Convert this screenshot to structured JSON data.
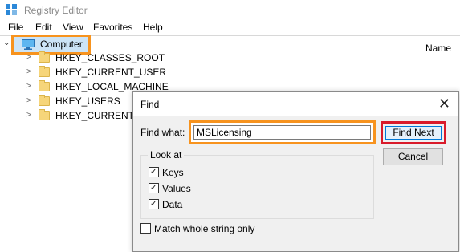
{
  "window": {
    "title": "Registry Editor",
    "menu": [
      "File",
      "Edit",
      "View",
      "Favorites",
      "Help"
    ]
  },
  "tree": {
    "root": "Computer",
    "items": [
      "HKEY_CLASSES_ROOT",
      "HKEY_CURRENT_USER",
      "HKEY_LOCAL_MACHINE",
      "HKEY_USERS",
      "HKEY_CURRENT_C"
    ]
  },
  "list": {
    "column_name": "Name"
  },
  "find_dialog": {
    "title": "Find",
    "close_glyph": "✕",
    "find_what_label": "Find what:",
    "find_what_value": "MSLicensing",
    "find_next_label": "Find Next",
    "cancel_label": "Cancel",
    "look_at_label": "Look at",
    "options": [
      {
        "label": "Keys",
        "checked": true
      },
      {
        "label": "Values",
        "checked": true
      },
      {
        "label": "Data",
        "checked": true
      }
    ],
    "match_whole": {
      "label": "Match whole string only",
      "checked": false
    }
  },
  "colors": {
    "highlight_orange": "#f7931e",
    "highlight_red": "#d91a2a",
    "folder": "#f6d57a",
    "selection": "#cce4f7"
  },
  "icons": {
    "app": "registry-editor-icon",
    "computer": "computer-icon",
    "folder": "folder-icon",
    "close": "close-icon"
  }
}
